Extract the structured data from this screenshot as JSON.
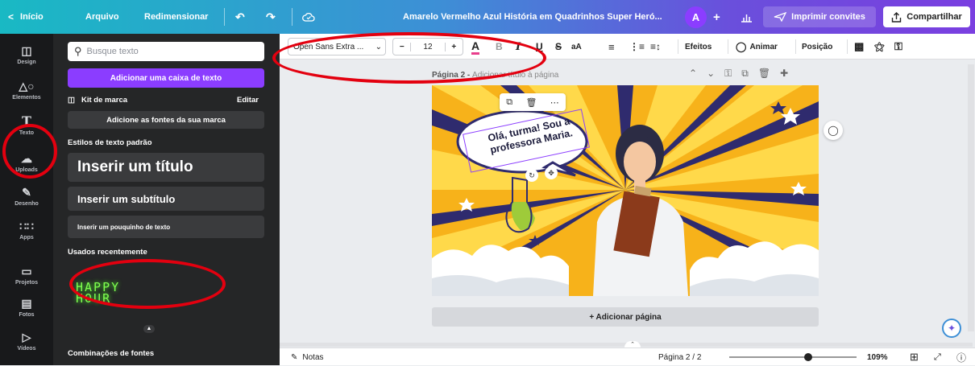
{
  "topbar": {
    "home": "Início",
    "file": "Arquivo",
    "resize": "Redimensionar",
    "title": "Amarelo Vermelho Azul História em Quadrinhos Super Heró...",
    "avatar": "A",
    "print": "Imprimir convites",
    "share": "Compartilhar"
  },
  "rail": [
    "Design",
    "Elementos",
    "Texto",
    "Uploads",
    "Desenho",
    "Apps",
    "Projetos",
    "Fotos",
    "Vídeos"
  ],
  "panel": {
    "search_placeholder": "Busque texto",
    "add_textbox": "Adicionar uma caixa de texto",
    "brand_kit": "Kit de marca",
    "edit": "Editar",
    "add_brand_fonts": "Adicione as fontes da sua marca",
    "default_styles": "Estilos de texto padrão",
    "heading": "Inserir um título",
    "subheading": "Inserir um subtítulo",
    "body": "Inserir um pouquinho de texto",
    "recent": "Usados recentemente",
    "recent_item": "HAPPY HOUR",
    "combos": "Combinações de fontes"
  },
  "toolbar": {
    "font": "Open Sans Extra ...",
    "font_size": "12",
    "effects": "Efeitos",
    "animate": "Animar",
    "position": "Posição"
  },
  "page": {
    "label": "Página 2",
    "title_placeholder": "Adicionar título à página",
    "speech": "Olá, turma! Sou a professora Maria.",
    "add_page": "+ Adicionar página"
  },
  "status": {
    "notes": "Notas",
    "page_indicator": "Página 2 / 2",
    "zoom": "109%",
    "zoom_fraction": 0.62
  },
  "colors": {
    "accent": "#8b3dff",
    "rail_bg": "#18191b",
    "panel_bg": "#252627",
    "annotation": "#e3000f",
    "neon": "#7fff4f"
  }
}
